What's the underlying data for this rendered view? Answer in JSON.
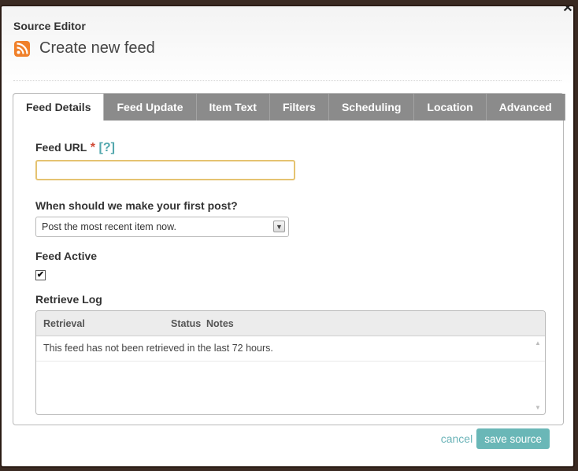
{
  "window": {
    "app_title": "Source Editor",
    "page_title": "Create new feed",
    "close_glyph": "✕"
  },
  "tabs": [
    {
      "label": "Feed Details",
      "active": true
    },
    {
      "label": "Feed Update"
    },
    {
      "label": "Item Text"
    },
    {
      "label": "Filters"
    },
    {
      "label": "Scheduling"
    },
    {
      "label": "Location"
    },
    {
      "label": "Advanced"
    }
  ],
  "form": {
    "feed_url_label": "Feed URL",
    "required_mark": "*",
    "help_link": "[?]",
    "feed_url_value": "",
    "first_post_label": "When should we make your first post?",
    "first_post_selected": "Post the most recent item now.",
    "feed_active_label": "Feed Active",
    "feed_active_checked": "✔",
    "retrieve_log_label": "Retrieve Log"
  },
  "log": {
    "columns": [
      "Retrieval",
      "Status",
      "Notes"
    ],
    "rows": [
      "This feed has not been retrieved in the last 72 hours."
    ]
  },
  "footer": {
    "cancel_label": "cancel",
    "save_label": "save source"
  },
  "colors": {
    "accent": "#6ab7b7",
    "rss": "#f0802a",
    "tab_bg": "#8b8b8b",
    "input_focus": "#e5c371",
    "required": "#d04a36"
  },
  "icons": {
    "rss": "rss-feed-icon",
    "select": "chevron-down-icon",
    "close": "close-icon"
  }
}
